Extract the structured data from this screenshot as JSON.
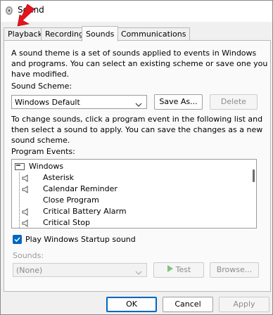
{
  "window": {
    "title": "Sound"
  },
  "tabs": [
    {
      "label": "Playback"
    },
    {
      "label": "Recording"
    },
    {
      "label": "Sounds"
    },
    {
      "label": "Communications"
    }
  ],
  "sounds": {
    "description": [
      "A sound theme is a set of sounds applied to events in Windows",
      "and programs.  You can select an existing scheme or save one you",
      "have modified."
    ],
    "scheme_label": "Sound Scheme:",
    "scheme_value": "Windows Default",
    "save_as_label": "Save As...",
    "delete_label": "Delete",
    "change_text": [
      "To change sounds, click a program event in the following list and",
      "then select a sound to apply.  You can save the changes as a new",
      "sound scheme."
    ],
    "program_events_label": "Program Events:",
    "events": [
      {
        "label": "Windows"
      },
      {
        "label": "Asterisk"
      },
      {
        "label": "Calendar Reminder"
      },
      {
        "label": "Close Program"
      },
      {
        "label": "Critical Battery Alarm"
      },
      {
        "label": "Critical Stop"
      }
    ],
    "startup_checkbox_label": "Play Windows Startup sound",
    "startup_checked": true,
    "sounds_label": "Sounds:",
    "sounds_value": "(None)",
    "test_label": "Test",
    "browse_label": "Browse..."
  },
  "footer": {
    "ok_label": "OK",
    "cancel_label": "Cancel",
    "apply_label": "Apply"
  },
  "colors": {
    "accent": "#0067c0",
    "annotation_arrow": "#e8141b"
  }
}
